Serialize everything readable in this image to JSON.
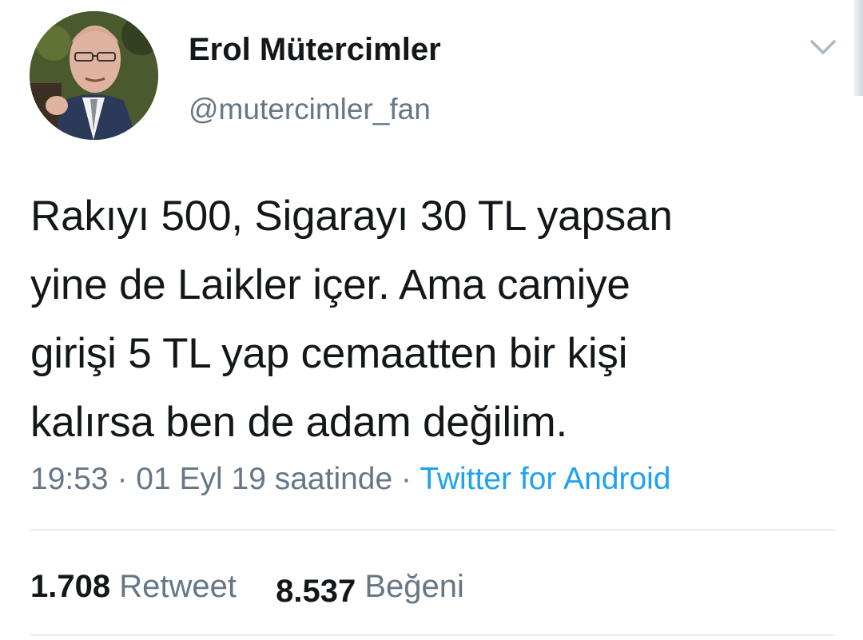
{
  "author": {
    "display_name": "Erol Mütercimler",
    "handle": "@mutercimler_fan"
  },
  "tweet": {
    "text": "Rakıyı 500, Sigarayı 30 TL yapsan\nyine de Laikler içer. Ama camiye\ngirişi 5 TL yap cemaatten bir kişi\nkalırsa ben de adam değilim.",
    "time": "19:53",
    "date": "01 Eyl 19 saatinde",
    "separator": "·",
    "source": "Twitter for Android"
  },
  "stats": {
    "retweets_count": "1.708",
    "retweets_label": "Retweet",
    "likes_count": "8.537",
    "likes_label": "Beğeni"
  },
  "icons": {
    "menu": "chevron-down-icon"
  },
  "colors": {
    "text": "#14171a",
    "secondary": "#657786",
    "link": "#1da1f2",
    "divider": "#e6ecf0"
  }
}
